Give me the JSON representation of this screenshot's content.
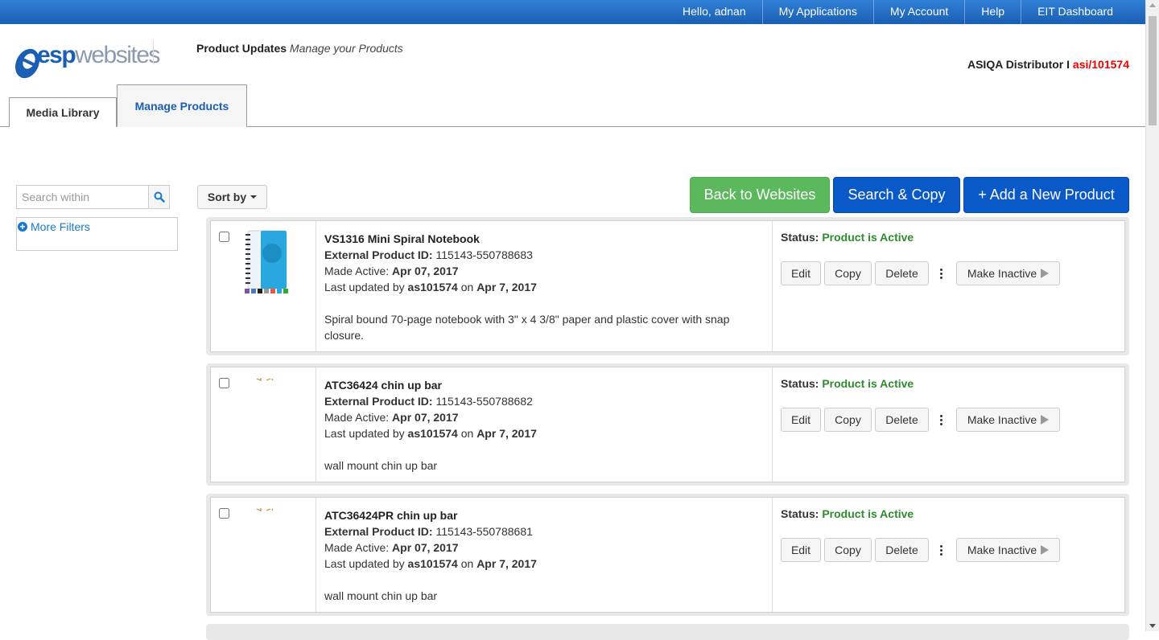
{
  "topnav": {
    "items": [
      "Hello, adnan",
      "My Applications",
      "My Account",
      "Help",
      "EIT Dashboard"
    ]
  },
  "header": {
    "logo_esp": "esp",
    "logo_web": "websites",
    "title_bold": "Product Updates",
    "title_italic": "Manage your Products",
    "account_label": "ASIQA Distributor I ",
    "account_id": "asi/101574"
  },
  "tabs": [
    {
      "label": "Media Library",
      "active": false
    },
    {
      "label": "Manage Products",
      "active": true
    }
  ],
  "sidebar": {
    "search_placeholder": "Search within",
    "more_filters": "More Filters"
  },
  "toolbar": {
    "sort_label": "Sort by",
    "back_label": "Back to Websites",
    "search_copy_label": "Search & Copy",
    "add_label": "+ Add a New Product"
  },
  "labels": {
    "external_id": "External Product ID:",
    "made_active": "Made Active:",
    "last_updated_by": "Last updated by",
    "on": "on",
    "status": "Status:",
    "edit": "Edit",
    "copy": "Copy",
    "delete": "Delete",
    "make_inactive": "Make Inactive"
  },
  "products": [
    {
      "title": "VS1316  Mini Spiral Notebook",
      "external_id": "115143-550788683",
      "made_active": "Apr 07, 2017",
      "updated_by": "as101574",
      "updated_on": "Apr 7, 2017",
      "description": "Spiral bound 70-page notebook with 3\" x 4 3/8\" paper and plastic cover with snap closure.",
      "status": "Product is Active",
      "thumb": "notebook-image"
    },
    {
      "title": "ATC36424  chin up bar",
      "external_id": "115143-550788682",
      "made_active": "Apr 07, 2017",
      "updated_by": "as101574",
      "updated_on": "Apr 7, 2017",
      "description": "wall mount chin up bar",
      "status": "Product is Active",
      "thumb": "chin-up-bar-image"
    },
    {
      "title": "ATC36424PR  chin up bar",
      "external_id": "115143-550788681",
      "made_active": "Apr 07, 2017",
      "updated_by": "as101574",
      "updated_on": "Apr 7, 2017",
      "description": "wall mount chin up bar",
      "status": "Product is Active",
      "thumb": "chin-up-bar-image"
    }
  ],
  "colors": {
    "nav_blue": "#1a5fb4",
    "green_btn": "#5cb85c",
    "blue_btn": "#0a59c9",
    "active_green": "#2e8b2e",
    "account_red": "#e00000"
  }
}
